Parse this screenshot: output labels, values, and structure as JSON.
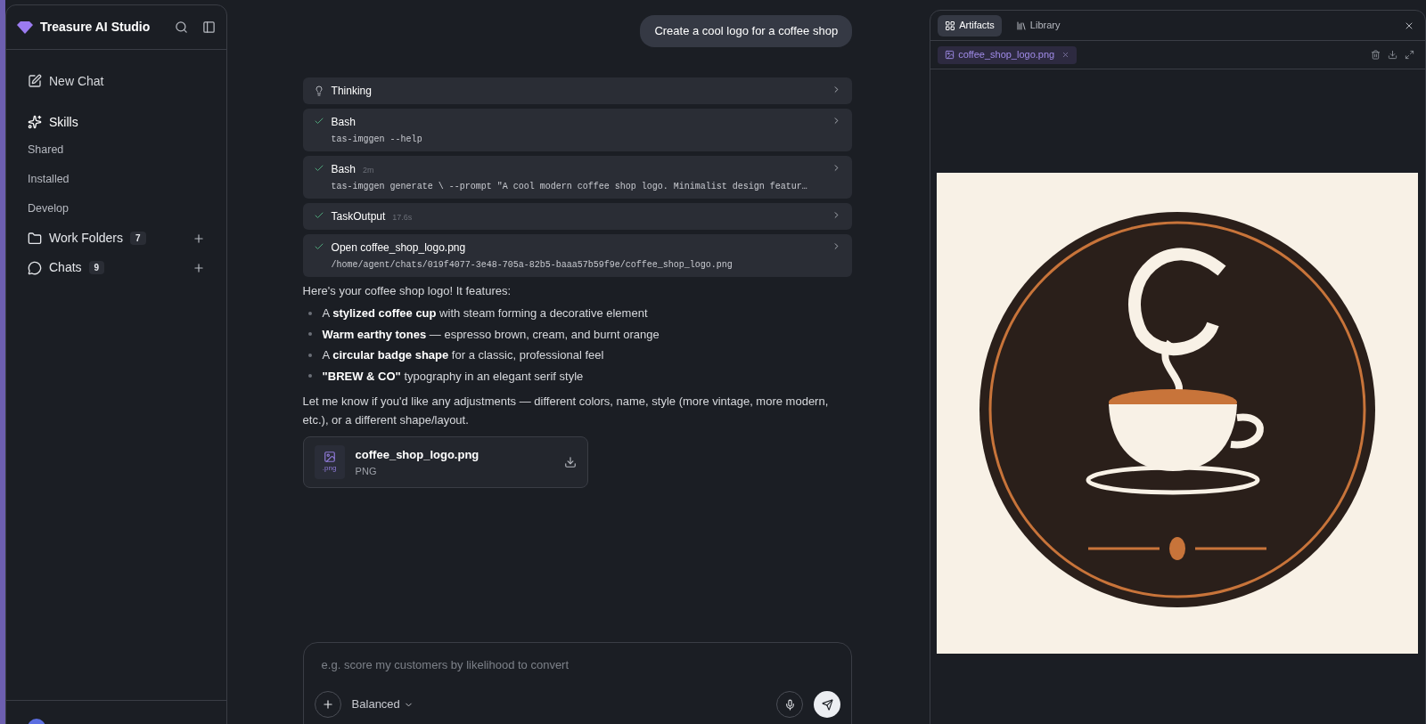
{
  "sidebar": {
    "brand": "Treasure AI Studio",
    "new_chat": "New Chat",
    "skills": {
      "label": "Skills",
      "items": [
        {
          "label": "Shared"
        },
        {
          "label": "Installed"
        },
        {
          "label": "Develop"
        }
      ]
    },
    "sections": [
      {
        "kind": "folder",
        "label": "Work Folders",
        "count": "7"
      },
      {
        "kind": "chat",
        "label": "Chats",
        "count": "9"
      }
    ]
  },
  "chat": {
    "user_message": "Create a cool logo for a coffee shop",
    "steps": [
      {
        "kind": "thinking",
        "title": "Thinking"
      },
      {
        "kind": "tool",
        "done": true,
        "title": "Bash",
        "detail": "tas-imggen --help"
      },
      {
        "kind": "tool",
        "done": true,
        "title": "Bash",
        "meta": "2m",
        "detail": "tas-imggen generate \\ --prompt \"A cool modern coffee shop logo. Minimalist design featur…"
      },
      {
        "kind": "tool",
        "done": true,
        "title": "TaskOutput",
        "meta": "17.6s"
      },
      {
        "kind": "tool",
        "done": true,
        "title": "Open coffee_shop_logo.png",
        "detail": "/home/agent/chats/019f4077-3e48-705a-82b5-baaa57b59f9e/coffee_shop_logo.png"
      }
    ],
    "intro": "Here's your coffee shop logo! It features:",
    "bullets": [
      "A **stylized coffee cup** with steam forming a decorative element",
      "**Warm earthy tones** — espresso brown, cream, and burnt orange",
      "A **circular badge shape** for a classic, professional feel",
      "**\"BREW & CO\"** typography in an elegant serif style"
    ],
    "outro": "Let me know if you'd like any adjustments — different colors, name, style (more vintage, more modern, etc.), or a different shape/layout.",
    "attachment": {
      "ext": ".png",
      "name": "coffee_shop_logo.png",
      "type": "PNG"
    }
  },
  "composer": {
    "placeholder": "e.g. score my customers by likelihood to convert",
    "mode": "Balanced"
  },
  "artifacts": {
    "tabs": [
      {
        "label": "Artifacts",
        "selected": true
      },
      {
        "label": "Library",
        "selected": false
      }
    ],
    "file_tab": "coffee_shop_logo.png"
  }
}
